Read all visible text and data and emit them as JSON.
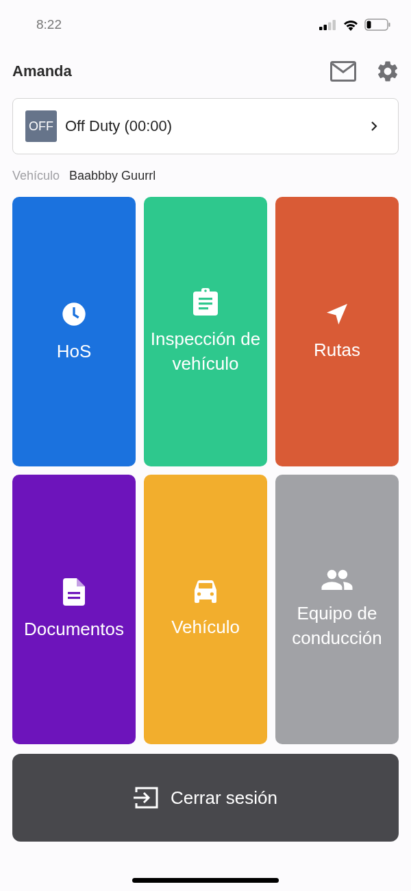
{
  "status_bar": {
    "time": "8:22"
  },
  "header": {
    "title": "Amanda"
  },
  "duty_status": {
    "badge": "OFF",
    "label": "Off Duty (00:00)"
  },
  "vehicle": {
    "label": "Vehículo",
    "value": "Baabbby Guurrl"
  },
  "tiles": [
    {
      "label": "HoS",
      "kind": "clock",
      "color": "#1b72de"
    },
    {
      "label": "Inspección de vehículo",
      "kind": "clipboard",
      "color": "#2ec88d"
    },
    {
      "label": "Rutas",
      "kind": "navigation",
      "color": "#d95b36"
    },
    {
      "label": "Documentos",
      "kind": "document",
      "color": "#6d14bb"
    },
    {
      "label": "Vehículo",
      "kind": "car",
      "color": "#f2ae2d"
    },
    {
      "label": "Equipo de conducción",
      "kind": "people",
      "color": "#a1a2a6"
    }
  ],
  "logout": {
    "label": "Cerrar sesión"
  }
}
